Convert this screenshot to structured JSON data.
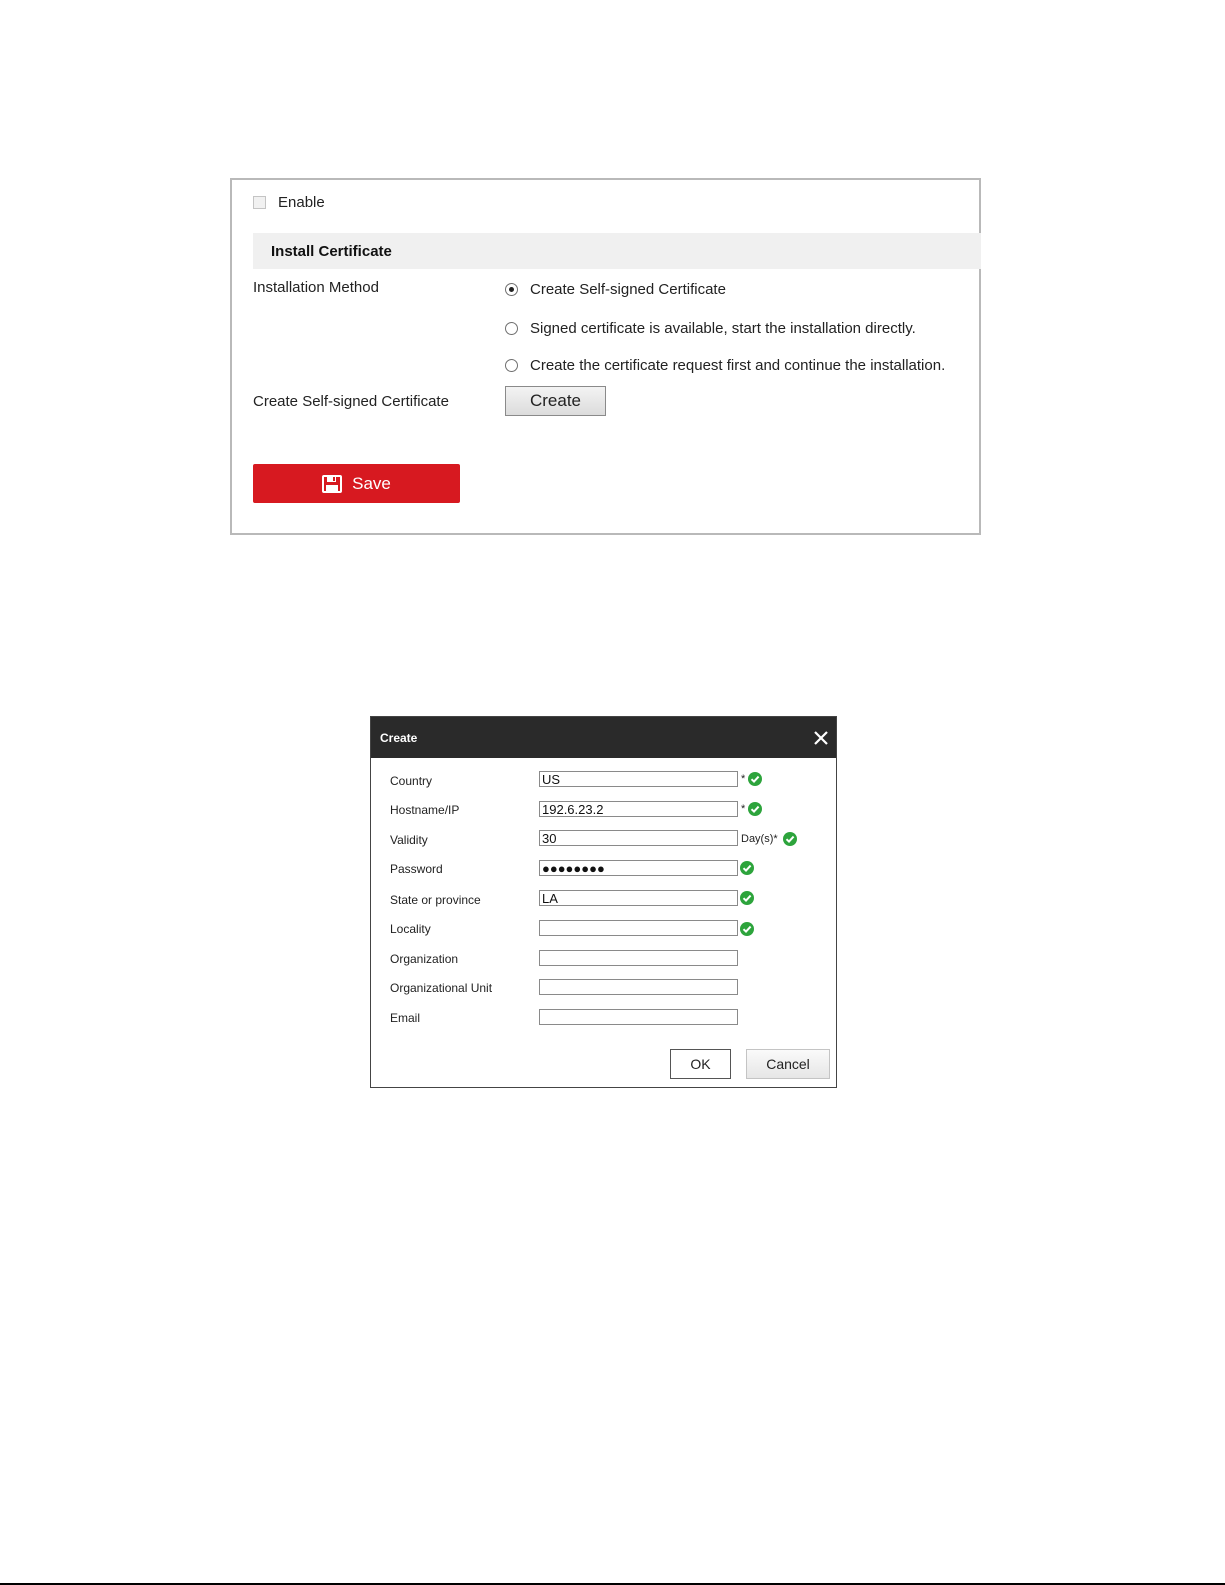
{
  "panel": {
    "enable_label": "Enable",
    "section_title": "Install Certificate",
    "installation_method_label": "Installation Method",
    "radio_options": [
      {
        "label": "Create Self-signed Certificate",
        "checked": true
      },
      {
        "label": "Signed certificate is available, start the installation directly.",
        "checked": false
      },
      {
        "label": "Create the certificate request first and continue the installation.",
        "checked": false
      }
    ],
    "create_row_label": "Create Self-signed Certificate",
    "create_button": "Create",
    "save_button": "Save",
    "save_color": "#d71920"
  },
  "dialog": {
    "title": "Create",
    "close_icon": "close-icon",
    "fields": [
      {
        "label": "Country",
        "value": "US",
        "suffix": "*",
        "valid": true
      },
      {
        "label": "Hostname/IP",
        "value": "192.6.23.2",
        "suffix": "*",
        "valid": true
      },
      {
        "label": "Validity",
        "value": "30",
        "suffix": "Day(s)*",
        "valid": true
      },
      {
        "label": "Password",
        "value": "●●●●●●●●",
        "suffix": "",
        "valid": true
      },
      {
        "label": "State or province",
        "value": "LA",
        "suffix": "",
        "valid": true
      },
      {
        "label": "Locality",
        "value": "",
        "suffix": "",
        "valid": true
      },
      {
        "label": "Organization",
        "value": "",
        "suffix": "",
        "valid": false
      },
      {
        "label": "Organizational Unit",
        "value": "",
        "suffix": "",
        "valid": false
      },
      {
        "label": "Email",
        "value": "",
        "suffix": "",
        "valid": false
      }
    ],
    "ok_button": "OK",
    "cancel_button": "Cancel",
    "valid_icon_color": "#2da43c"
  }
}
